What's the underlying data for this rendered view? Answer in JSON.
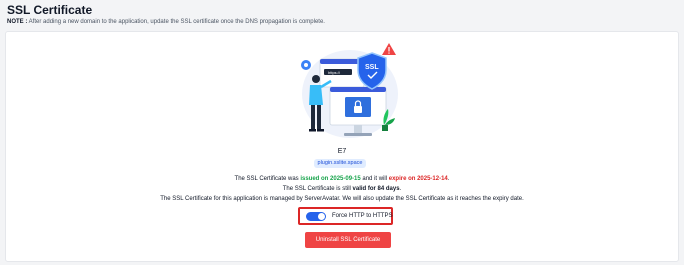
{
  "header": {
    "title": "SSL Certificate",
    "note_label": "NOTE :",
    "note_text": " After adding a new domain to the application, update the SSL certificate once the DNS propagation is complete."
  },
  "illustration": {
    "address_text": "https://",
    "shield_text": "SSL",
    "icons": [
      "gear-icon",
      "warning-icon",
      "padlock-icon",
      "shield-check-icon",
      "plant-icon",
      "person-figure"
    ]
  },
  "certificate": {
    "name": "E7",
    "domain": "plugin.sslite.space",
    "line1": {
      "prefix": "The SSL Certificate was ",
      "issued": "issued on 2025-09-15",
      "middle": " and it will ",
      "expire": "expire on 2025-12-14",
      "suffix": "."
    },
    "line2": {
      "prefix": "The SSL Certificate is still ",
      "valid": "valid for 84 days",
      "suffix": "."
    },
    "line3": "The SSL Certificate for this application is managed by ServerAvatar. We will also update the SSL Certificate as it reaches the expiry date."
  },
  "force_https": {
    "label": "Force HTTP to HTTPS",
    "enabled": true
  },
  "actions": {
    "uninstall_label": "Uninstall SSL Certificate"
  },
  "colors": {
    "accent": "#2563eb",
    "danger": "#ef4444",
    "success": "#16a34a",
    "background": "#f3f4f6"
  }
}
